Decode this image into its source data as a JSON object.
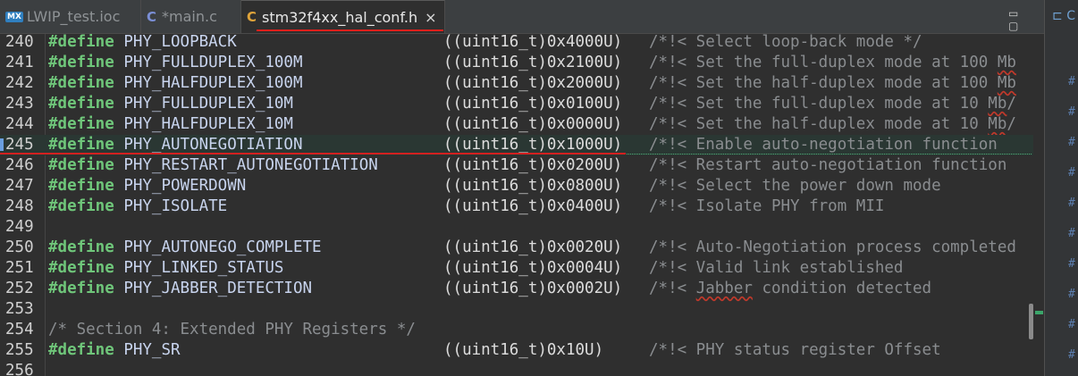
{
  "tabs": [
    {
      "label": "LWIP_test.ioc",
      "icon": "MX",
      "close": ""
    },
    {
      "label": "*main.c",
      "icon": "C",
      "close": ""
    },
    {
      "label": "stm32f4xx_hal_conf.h",
      "icon": "C",
      "close": "×"
    }
  ],
  "window_buttons": "▭ ▢",
  "outline": {
    "header": "C",
    "hash": "#"
  },
  "lines": [
    {
      "n": "240",
      "kw": "#define",
      "macro": "PHY_LOOPBACK",
      "value": "((uint16_t)0x4000U)",
      "comment": "/*!< Select loop-back mode */"
    },
    {
      "n": "241",
      "kw": "#define",
      "macro": "PHY_FULLDUPLEX_100M",
      "value": "((uint16_t)0x2100U)",
      "comment": "/*!< Set the full-duplex mode at 100 ",
      "sq": "Mb"
    },
    {
      "n": "242",
      "kw": "#define",
      "macro": "PHY_HALFDUPLEX_100M",
      "value": "((uint16_t)0x2000U)",
      "comment": "/*!< Set the half-duplex mode at 100 ",
      "sq": "Mb"
    },
    {
      "n": "243",
      "kw": "#define",
      "macro": "PHY_FULLDUPLEX_10M",
      "value": "((uint16_t)0x0100U)",
      "comment": "/*!< Set the full-duplex mode at 10 ",
      "sq": "Mb",
      "tail": "/"
    },
    {
      "n": "244",
      "kw": "#define",
      "macro": "PHY_HALFDUPLEX_10M",
      "value": "((uint16_t)0x0000U)",
      "comment": "/*!< Set the half-duplex mode at 10 ",
      "sq": "Mb",
      "tail": "/"
    },
    {
      "n": "245",
      "kw": "#define",
      "macro": "PHY_AUTONEGOTIATION",
      "value": "((uint16_t)0x1000U)",
      "comment": "/*!< Enable auto-negotiation function",
      "hl": true
    },
    {
      "n": "246",
      "kw": "#define",
      "macro": "PHY_RESTART_AUTONEGOTIATION",
      "value": "((uint16_t)0x0200U)",
      "comment": "/*!< Restart auto-negotiation function"
    },
    {
      "n": "247",
      "kw": "#define",
      "macro": "PHY_POWERDOWN",
      "value": "((uint16_t)0x0800U)",
      "comment": "/*!< Select the power down mode"
    },
    {
      "n": "248",
      "kw": "#define",
      "macro": "PHY_ISOLATE",
      "value": "((uint16_t)0x0400U)",
      "comment": "/*!< Isolate PHY from MII"
    },
    {
      "n": "249"
    },
    {
      "n": "250",
      "kw": "#define",
      "macro": "PHY_AUTONEGO_COMPLETE",
      "value": "((uint16_t)0x0020U)",
      "comment": "/*!< Auto-Negotiation process completed"
    },
    {
      "n": "251",
      "kw": "#define",
      "macro": "PHY_LINKED_STATUS",
      "value": "((uint16_t)0x0004U)",
      "comment": "/*!< Valid link established"
    },
    {
      "n": "252",
      "kw": "#define",
      "macro": "PHY_JABBER_DETECTION",
      "value": "((uint16_t)0x0002U)",
      "comment": "/*!< ",
      "sq": "Jabber",
      "tail": " condition detected"
    },
    {
      "n": "253"
    },
    {
      "n": "254",
      "fullcomment": "/* Section 4: Extended PHY Registers */"
    },
    {
      "n": "255",
      "kw": "#define",
      "macro": "PHY_SR",
      "value": "((uint16_t)0x10U)",
      "comment": "/*!< PHY status register Offset"
    },
    {
      "n": "256"
    }
  ]
}
